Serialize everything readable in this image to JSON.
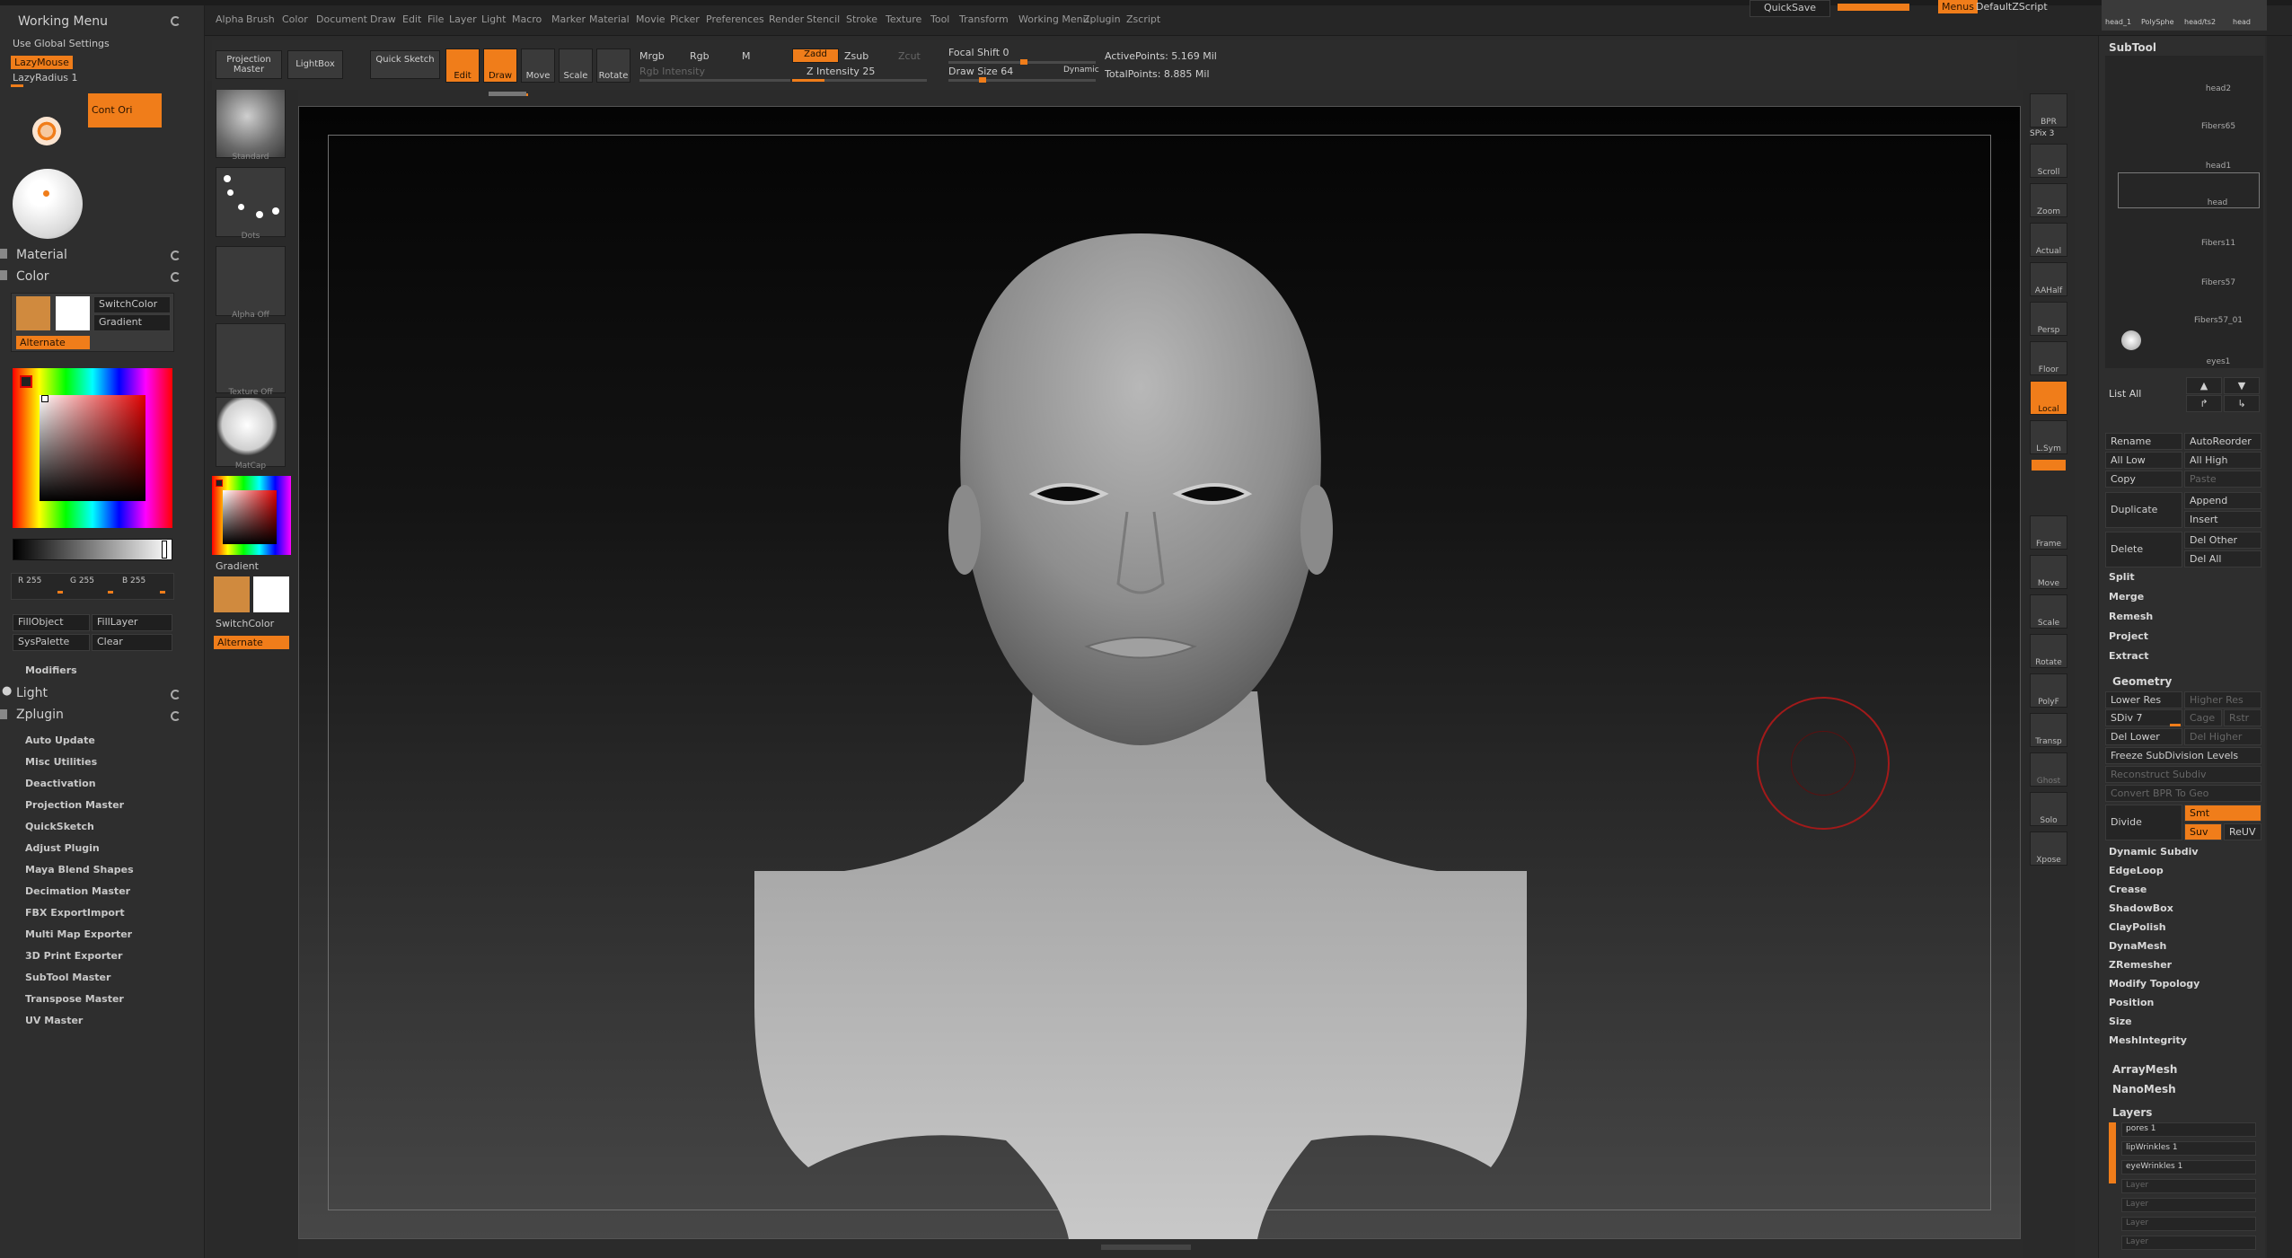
{
  "menu": {
    "items": [
      "Alpha",
      "Brush",
      "Color",
      "Document",
      "Draw",
      "Edit",
      "File",
      "Layer",
      "Light",
      "Macro",
      "Marker",
      "Material",
      "Movie",
      "Picker",
      "Preferences",
      "Render",
      "Stencil",
      "Stroke",
      "Texture",
      "Tool",
      "Transform",
      "Working Menu",
      "Zplugin",
      "Zscript"
    ],
    "quicksave": "QuickSave",
    "menus_btn": "Menus",
    "script": "DefaultZScript"
  },
  "left": {
    "working_menu": "Working Menu",
    "use_global": "Use Global Settings",
    "lazymouse": "LazyMouse",
    "lazyradius": "LazyRadius 1",
    "cont_ori": "Cont Ori",
    "material": "Material",
    "color": "Color",
    "switch_color": "SwitchColor",
    "gradient": "Gradient",
    "alternate": "Alternate",
    "r": "R 255",
    "g": "G 255",
    "b": "B 255",
    "fill_object": "FillObject",
    "fill_layer": "FillLayer",
    "sys_palette": "SysPalette",
    "clear": "Clear",
    "modifiers": "Modifiers",
    "light": "Light",
    "zplugin": "Zplugin",
    "plugins": [
      "Auto Update",
      "Misc Utilities",
      "Deactivation",
      "Projection Master",
      "QuickSketch",
      "Adjust Plugin",
      "Maya Blend Shapes",
      "Decimation Master",
      "FBX ExportImport",
      "Multi Map Exporter",
      "3D Print Exporter",
      "SubTool Master",
      "Transpose Master",
      "UV Master"
    ]
  },
  "shelf": {
    "standard": "Standard",
    "dots": "Dots",
    "alpha_off": "Alpha Off",
    "texture_off": "Texture Off",
    "matcap": "MatCap",
    "gradient": "Gradient",
    "switch_color": "SwitchColor",
    "alternate": "Alternate"
  },
  "toolbar": {
    "projection_master": "Projection Master",
    "lightbox": "LightBox",
    "quick_sketch": "Quick Sketch",
    "edit": "Edit",
    "draw": "Draw",
    "move": "Move",
    "scale": "Scale",
    "rotate": "Rotate",
    "mrgb": "Mrgb",
    "rgb": "Rgb",
    "m": "M",
    "rgb_intensity": "Rgb Intensity",
    "zadd": "Zadd",
    "zsub": "Zsub",
    "zcut": "Zcut",
    "z_intensity": "Z Intensity 25",
    "focal_shift": "Focal Shift 0",
    "draw_size": "Draw Size 64",
    "dynamic": "Dynamic",
    "active_points": "ActivePoints: 5.169 Mil",
    "total_points": "TotalPoints: 8.885 Mil"
  },
  "rightstrip": [
    "BPR",
    "SPix 3",
    "Scroll",
    "Zoom",
    "Actual",
    "AAHalf",
    "Persp",
    "Floor",
    "Local",
    "L.Sym",
    "Frame",
    "Move",
    "Scale",
    "Rotate",
    "PolyF",
    "Transp",
    "Ghost",
    "Solo",
    "Xpose"
  ],
  "subtool": {
    "header": "SubTool",
    "top_names": [
      "head_1",
      "PolySphe",
      "head/ts2",
      "head"
    ],
    "items": [
      "head2",
      "Fibers65",
      "head1",
      "head",
      "Fibers11",
      "Fibers57",
      "Fibers57_01",
      "eyes1"
    ],
    "list_all": "List All",
    "rename": "Rename",
    "auto_reorder": "AutoReorder",
    "all_low": "All Low",
    "all_high": "All High",
    "copy": "Copy",
    "paste": "Paste",
    "duplicate": "Duplicate",
    "append": "Append",
    "insert": "Insert",
    "delete": "Delete",
    "del_other": "Del Other",
    "del_all": "Del All",
    "actions": [
      "Split",
      "Merge",
      "Remesh",
      "Project",
      "Extract"
    ]
  },
  "geometry": {
    "header": "Geometry",
    "lower_res": "Lower Res",
    "higher_res": "Higher Res",
    "sdiv": "SDiv 7",
    "cage": "Cage",
    "rstr": "Rstr",
    "del_lower": "Del Lower",
    "del_higher": "Del Higher",
    "freeze": "Freeze SubDivision Levels",
    "reconstruct": "Reconstruct Subdiv",
    "convert": "Convert BPR To Geo",
    "divide": "Divide",
    "smt": "Smt",
    "suv": "Suv",
    "reuv": "ReUV",
    "items": [
      "Dynamic Subdiv",
      "EdgeLoop",
      "Crease",
      "ShadowBox",
      "ClayPolish",
      "DynaMesh",
      "ZRemesher",
      "Modify Topology",
      "Position",
      "Size",
      "MeshIntegrity"
    ]
  },
  "extra": [
    "ArrayMesh",
    "NanoMesh"
  ],
  "layers": {
    "header": "Layers",
    "items": [
      "pores 1",
      "lipWrinkles 1",
      "eyeWrinkles 1"
    ],
    "empty": [
      "Layer",
      "Layer",
      "Layer",
      "Layer"
    ]
  }
}
